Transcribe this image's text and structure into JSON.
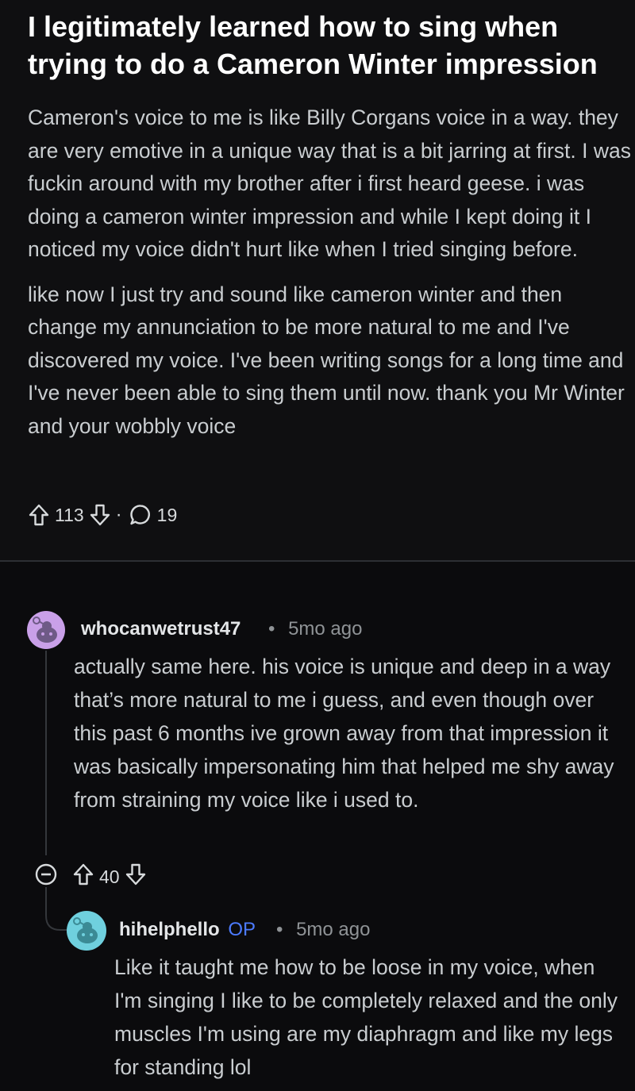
{
  "post": {
    "title": "I legitimately learned how to sing when trying to do a Cameron Winter impression",
    "paragraphs": [
      "Cameron's voice to me is like Billy Corgans voice in a way. they are very emotive in a unique way that is a bit jarring at first. I was fuckin around with my brother after i first heard geese. i was doing a cameron winter impression and while I kept doing it I noticed my voice didn't hurt like when I tried singing before.",
      "like now I just try and sound like cameron winter and then change my annunciation to be more natural to me and I've discovered my voice. I've been writing songs for a long time and I've never been able to sing them until now. thank you Mr Winter and your wobbly voice"
    ],
    "score": "113",
    "separator": "·",
    "comment_count": "19",
    "icons": [
      "upvote-icon",
      "downvote-icon",
      "comment-icon"
    ]
  },
  "comments": [
    {
      "username": "whocanwetrust47",
      "separator": "•",
      "age": "5mo ago",
      "avatar_color": "#c9a0e8",
      "body": "actually same here. his voice is unique and deep in a way that’s more natural to me i guess, and even though over this past 6 months ive grown away from that impression it was basically impersonating him that helped me shy away from straining my voice like i used to.",
      "score": "40",
      "icons": [
        "collapse-icon",
        "upvote-icon",
        "downvote-icon"
      ]
    },
    {
      "username": "hihelphello",
      "op_badge": "OP",
      "separator": "•",
      "age": "5mo ago",
      "avatar_color": "#6fd0de",
      "body": "Like it taught me how to be loose in my voice, when I'm singing I like to be completely relaxed and the only muscles I'm using are my diaphragm and like my legs for standing lol"
    }
  ],
  "colors": {
    "background": "#0b0b0d",
    "text": "#d7dadc",
    "muted": "#8f9396",
    "op_badge": "#4c7bff"
  }
}
